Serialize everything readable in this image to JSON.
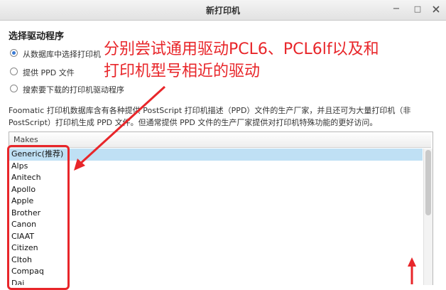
{
  "window": {
    "title": "新打印机",
    "minimize_glyph": "−",
    "maximize_glyph": "□",
    "close_icon": "close-icon"
  },
  "driver_selection": {
    "heading": "选择驱动程序",
    "options": [
      {
        "label": "从数据库中选择打印机",
        "checked": true
      },
      {
        "label": "提供 PPD 文件",
        "checked": false
      },
      {
        "label": "搜索要下载的打印机驱动程序",
        "checked": false
      }
    ],
    "description_line1": "Foomatic 打印机数据库含有各种提供 PostScript 打印机描述（PPD）文件的生产厂家，并且还可为大量打印机（非",
    "description_line2": "PostScript）打印机生成 PPD 文件。但通常提供 PPD 文件的生产厂家提供对打印机特殊功能的更好访问。"
  },
  "makes_list": {
    "header": "Makes",
    "items": [
      "Generic(推荐)",
      "Alps",
      "Anitech",
      "Apollo",
      "Apple",
      "Brother",
      "Canon",
      "CIAAT",
      "Citizen",
      "CItoh",
      "Compaq",
      "Dai"
    ],
    "selected_index": 0
  },
  "annotation": {
    "line1": "分别尝试通用驱动PCL6、PCL6lf以及和",
    "line2": "打印机型号相近的驱动",
    "color": "#e8262a"
  },
  "colors": {
    "selection": "#bfe0f4",
    "accent": "#3a7bd5"
  }
}
